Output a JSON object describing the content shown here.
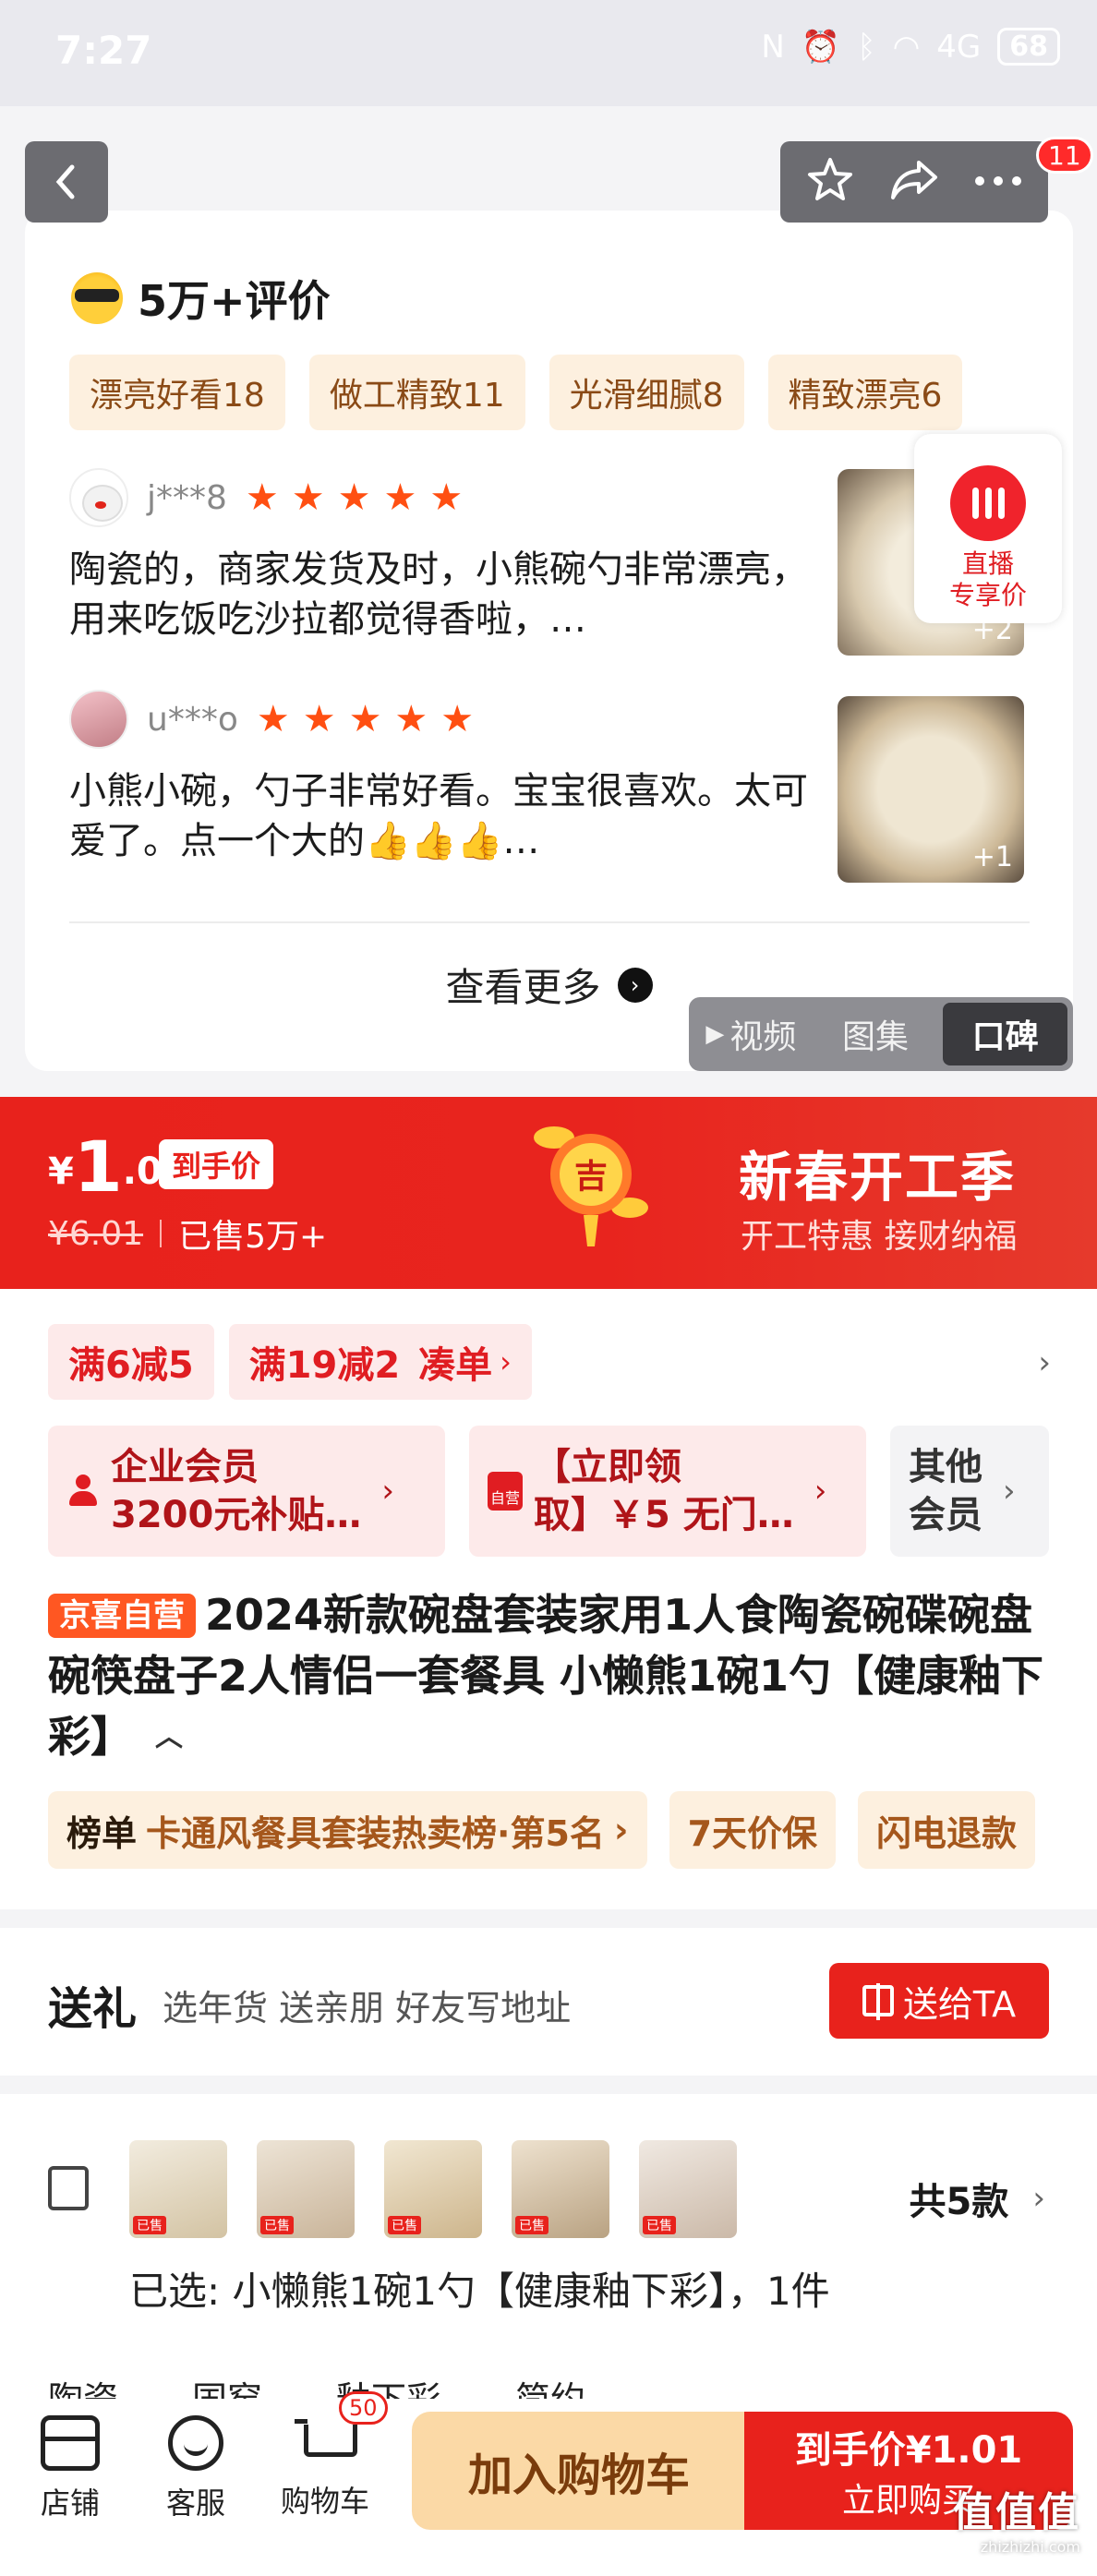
{
  "status_bar": {
    "time": "7:27",
    "signal": "4G",
    "battery": "68"
  },
  "top_nav": {
    "notification_count": "11"
  },
  "reviews": {
    "title": "5万+评价",
    "tags": [
      "漂亮好看18",
      "做工精致11",
      "光滑细腻8",
      "精致漂亮6"
    ],
    "items": [
      {
        "user": "j***8",
        "stars": 5,
        "text": "陶瓷的，商家发货及时，小熊碗勺非常漂亮，用来吃饭吃沙拉都觉得香啦，…",
        "photo_count": "+2"
      },
      {
        "user": "u***o",
        "stars": 5,
        "text": "小熊小碗，勺子非常好看。宝宝很喜欢。太可爱了。点一个大的👍👍👍…",
        "photo_count": "+1"
      }
    ],
    "see_more": "查看更多"
  },
  "live": {
    "label": "直播\n专享价"
  },
  "media_tabs": [
    {
      "label": "视频",
      "active": false
    },
    {
      "label": "图集",
      "active": false
    },
    {
      "label": "口碑",
      "active": true
    }
  ],
  "price": {
    "yen": "¥",
    "integer": "1",
    "decimal": ".01",
    "tag": "到手价",
    "original": "¥6.01",
    "sold": "已售5万+",
    "charm_text": "吉",
    "promo_title": "新春开工季",
    "promo_sub": "开工特惠 接财纳福"
  },
  "coupons": [
    "满6减5",
    "满19减2",
    "凑单"
  ],
  "members": [
    {
      "text": "企业会员\n3200元补贴…"
    },
    {
      "text": "【立即领\n取】￥5 无门…",
      "icon_label": "自营"
    },
    {
      "text": "其他\n会员"
    }
  ],
  "product": {
    "badge": "京喜自营",
    "title": "2024新款碗盘套装家用1人食陶瓷碗碟碗盘碗筷盘子2人情侣一套餐具 小懒熊1碗1勺【健康釉下彩】"
  },
  "rank": {
    "label": "榜单",
    "text": "卡通风餐具套装热卖榜·第5名"
  },
  "services": [
    "7天价保",
    "闪电退款"
  ],
  "gift": {
    "title": "送礼",
    "sub": "选年货 送亲朋 好友写地址",
    "button": "送给TA"
  },
  "spec": {
    "count": "共5款",
    "selected": "已选:  小懒熊1碗1勺【健康釉下彩】，1件",
    "thumb_label": "已售",
    "next_row": [
      "陶瓷",
      "国窑",
      "釉下彩",
      "简约"
    ]
  },
  "bottom_bar": {
    "shop": "店铺",
    "service": "客服",
    "cart": "购物车",
    "cart_count": "50",
    "add_cart": "加入购物车",
    "buy_top": "到手价¥1.01",
    "buy_bottom": "立即购买"
  },
  "watermark": {
    "text": "值值值",
    "sub": "zhizhizhi.com"
  }
}
